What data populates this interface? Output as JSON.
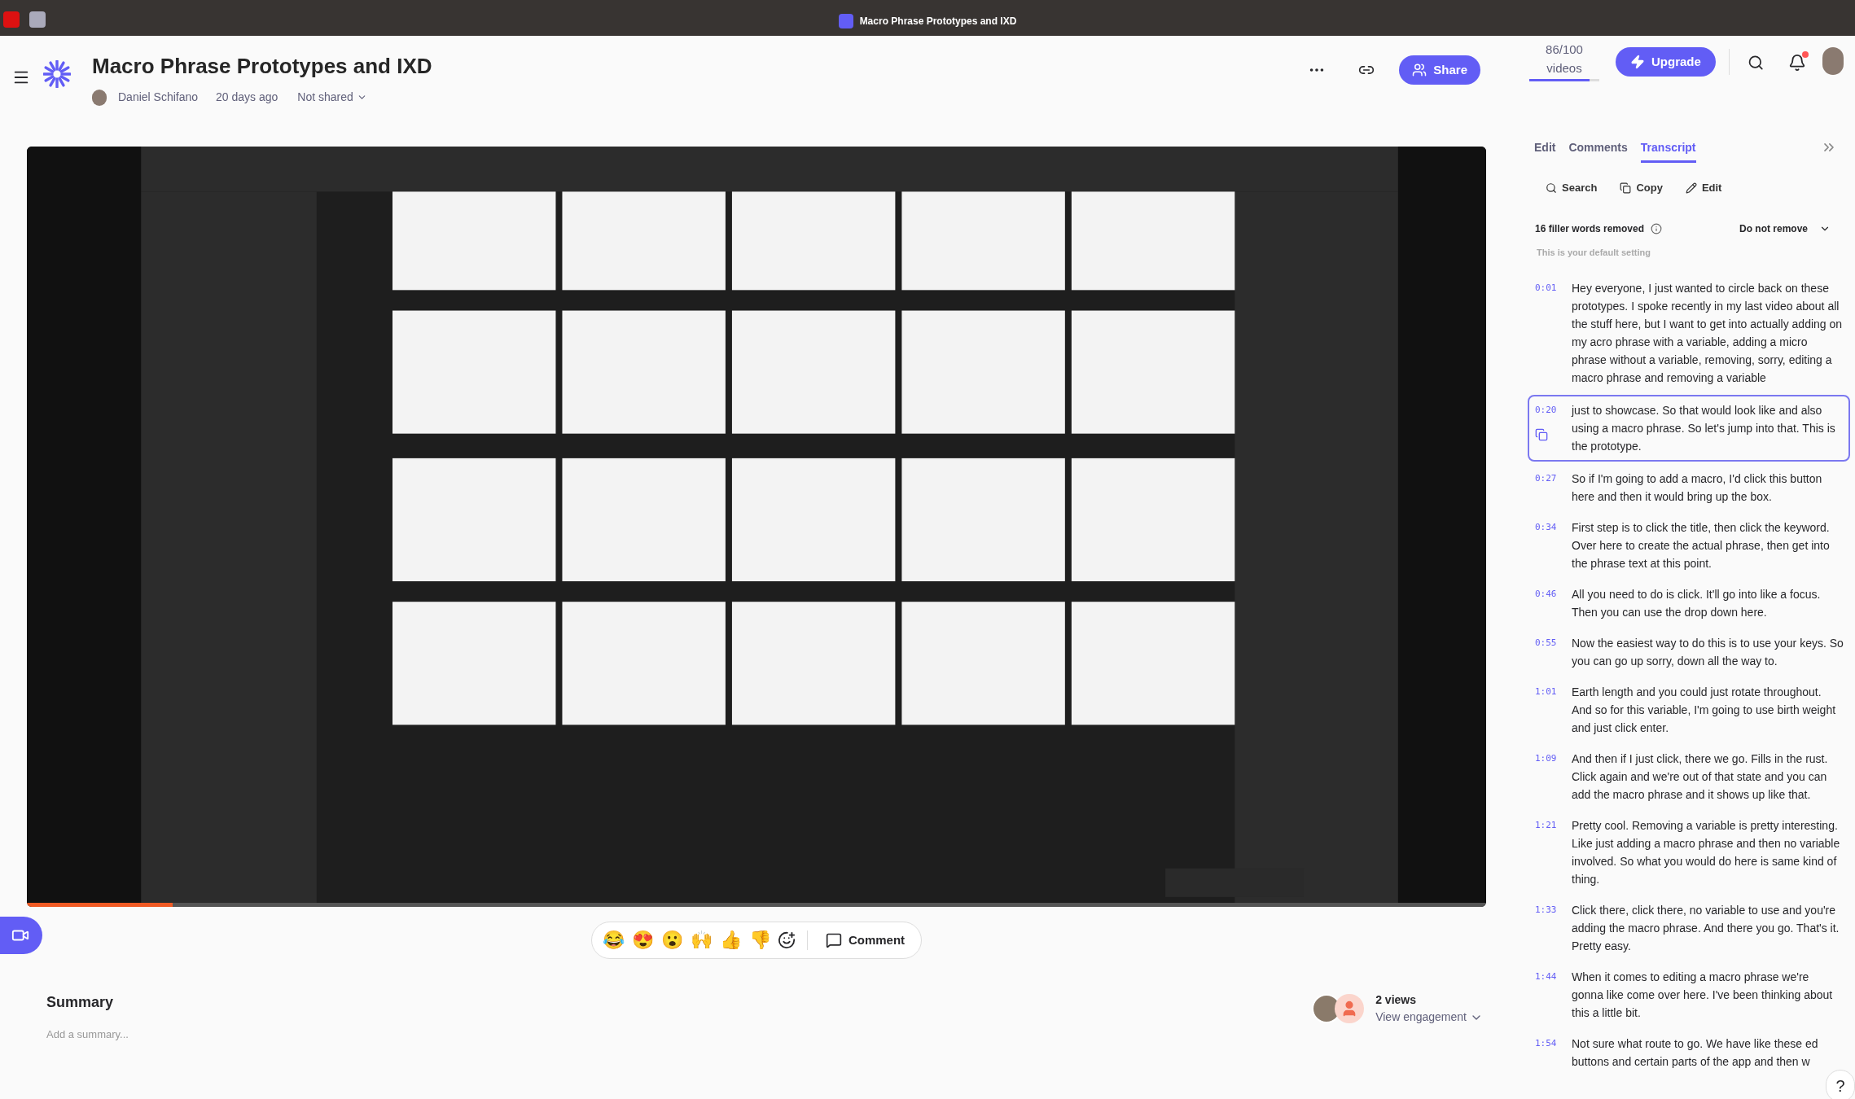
{
  "window": {
    "title": "Macro Phrase Prototypes and IXD"
  },
  "header": {
    "title": "Macro Phrase Prototypes and IXD",
    "author": "Daniel Schifano",
    "age": "20 days ago",
    "sharing": "Not shared",
    "share_button": "Share",
    "quota": {
      "count": "86/100",
      "unit": "videos",
      "level": 0.86
    },
    "upgrade_button": "Upgrade",
    "has_notification": true
  },
  "video": {
    "progress": {
      "level": 0.1
    }
  },
  "reactions": {
    "emojis": [
      "😂",
      "😍",
      "😮",
      "🙌",
      "👍",
      "👎"
    ],
    "comment_button": "Comment"
  },
  "summary": {
    "title": "Summary",
    "placeholder": "Add a summary...",
    "views": "2 views",
    "engagement": "View engagement"
  },
  "panel": {
    "tabs": [
      {
        "label": "Edit",
        "selected": false
      },
      {
        "label": "Comments",
        "selected": false
      },
      {
        "label": "Transcript",
        "selected": true
      }
    ],
    "actions": [
      "Search",
      "Copy",
      "Edit"
    ],
    "filler": {
      "label": "16 filler words removed",
      "option": "Do not remove",
      "note": "This is your default setting"
    },
    "transcript": [
      {
        "time": "0:01",
        "text": "Hey everyone, I just wanted to circle back on these prototypes. I spoke recently in my last video about all the stuff here, but I want to get into actually adding on my acro phrase with a variable, adding a micro phrase without a variable, removing, sorry, editing a macro phrase and removing a variable",
        "selected": false
      },
      {
        "time": "0:20",
        "text": "just to showcase. So that would look like and also using a macro phrase. So let's jump into that. This is the prototype.",
        "selected": true
      },
      {
        "time": "0:27",
        "text": "So if I'm going to add a macro, I'd click this button here and then it would bring up the box.",
        "selected": false
      },
      {
        "time": "0:34",
        "text": "First step is to click the title, then click the keyword. Over here to create the actual phrase, then get into the phrase text at this point.",
        "selected": false
      },
      {
        "time": "0:46",
        "text": "All you need to do is click. It'll go into like a focus. Then you can use the drop down here.",
        "selected": false
      },
      {
        "time": "0:55",
        "text": "Now the easiest way to do this is to use your keys. So you can go up sorry, down all the way to.",
        "selected": false
      },
      {
        "time": "1:01",
        "text": "Earth length and you could just rotate throughout. And so for this variable, I'm going to use birth weight and just click enter.",
        "selected": false
      },
      {
        "time": "1:09",
        "text": "And then if I just click, there we go. Fills in the rust. Click again and we're out of that state and you can add the macro phrase and it shows up like that.",
        "selected": false
      },
      {
        "time": "1:21",
        "text": "Pretty cool. Removing a variable is pretty interesting. Like just adding a macro phrase and then no variable involved. So what you would do here is same kind of thing.",
        "selected": false
      },
      {
        "time": "1:33",
        "text": "Click there, click there, no variable to use and you're adding the macro phrase. And there you go. That's it. Pretty easy.",
        "selected": false
      },
      {
        "time": "1:44",
        "text": "When it comes to editing a macro phrase we're gonna like come over here. I've been thinking about this a little bit.",
        "selected": false
      },
      {
        "time": "1:54",
        "lines": [
          "Not sure what route to go. We have like these ed",
          "buttons and certain parts of the app and then w"
        ],
        "selected": false
      }
    ],
    "help": "?"
  }
}
